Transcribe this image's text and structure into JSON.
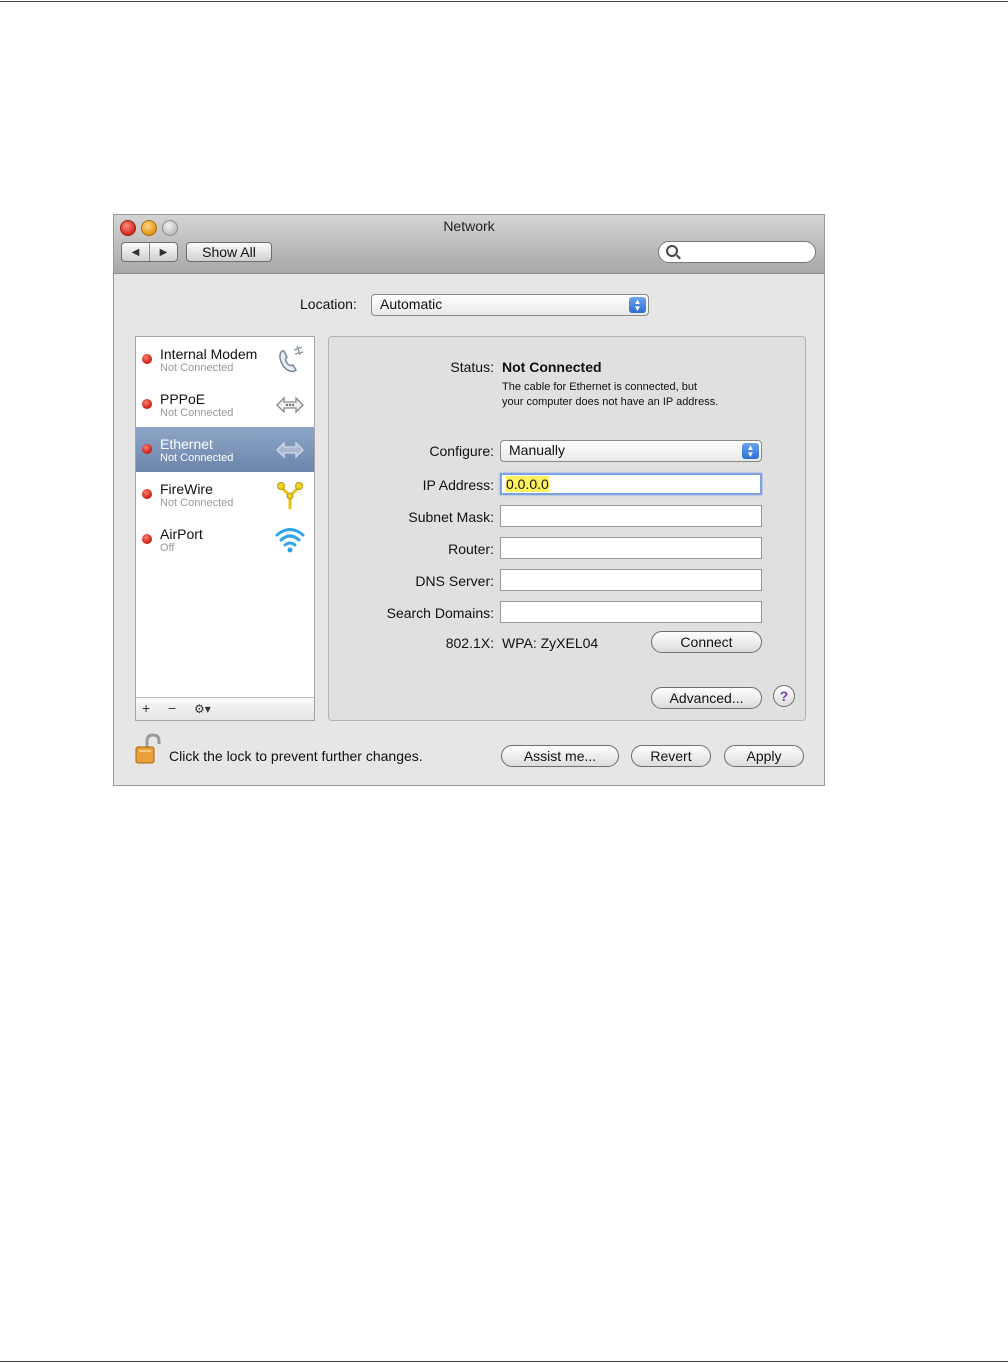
{
  "window": {
    "title": "Network",
    "show_all": "Show All",
    "nav_back": "◀",
    "nav_forward": "▶"
  },
  "location": {
    "label": "Location:",
    "value": "Automatic"
  },
  "services": [
    {
      "name": "Internal Modem",
      "status": "Not Connected",
      "icon": "phone-icon"
    },
    {
      "name": "PPPoE",
      "status": "Not Connected",
      "icon": "arrows-icon"
    },
    {
      "name": "Ethernet",
      "status": "Not Connected",
      "icon": "ethernet-icon",
      "selected": true
    },
    {
      "name": "FireWire",
      "status": "Not Connected",
      "icon": "firewire-icon"
    },
    {
      "name": "AirPort",
      "status": "Off",
      "icon": "wifi-icon"
    }
  ],
  "sidebar_footer": {
    "add": "+",
    "remove": "−",
    "gear": "⚙▾"
  },
  "detail": {
    "status_label": "Status:",
    "status_value": "Not Connected",
    "status_desc_1": "The cable for Ethernet is connected, but",
    "status_desc_2": "your computer does not have an IP address.",
    "configure_label": "Configure:",
    "configure_value": "Manually",
    "ip_label": "IP Address:",
    "ip_value": "0.0.0.0",
    "subnet_label": "Subnet Mask:",
    "subnet_value": "",
    "router_label": "Router:",
    "router_value": "",
    "dns_label": "DNS Server:",
    "dns_value": "",
    "search_label": "Search Domains:",
    "search_value": "",
    "dot1x_label": "802.1X:",
    "dot1x_value": "WPA: ZyXEL04",
    "connect": "Connect",
    "advanced": "Advanced...",
    "help": "?"
  },
  "footer": {
    "lock_text": "Click the lock to prevent further changes.",
    "assist": "Assist me...",
    "revert": "Revert",
    "apply": "Apply"
  },
  "colors": {
    "selected_row": "#7d95b9",
    "highlight": "#fff35c",
    "accent": "#2b6fd1"
  }
}
